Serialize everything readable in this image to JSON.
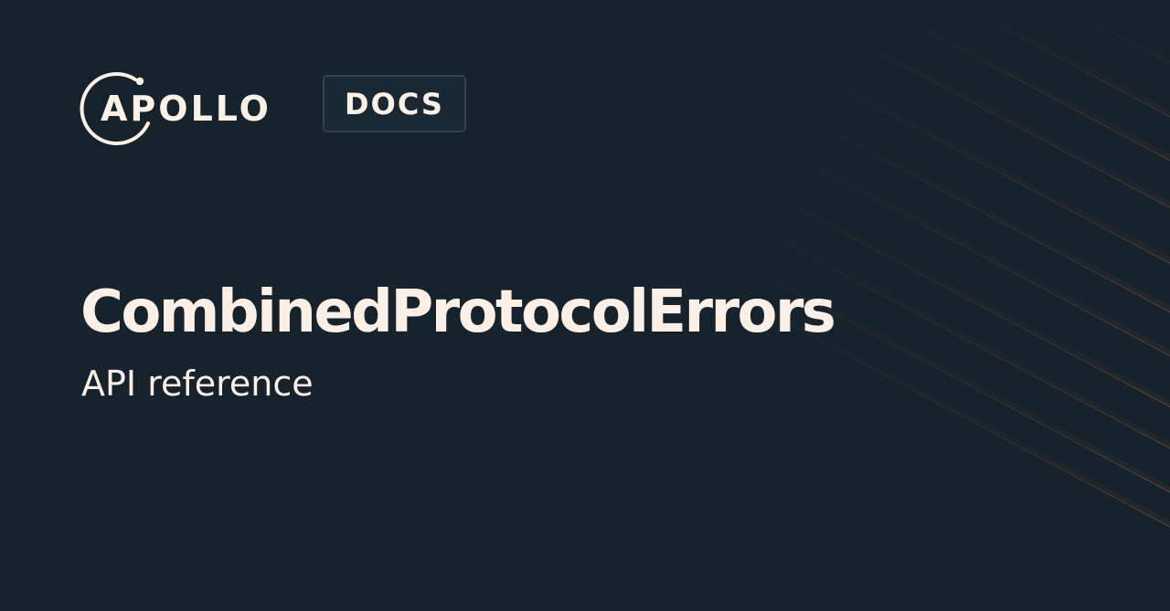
{
  "brand": {
    "wordmark": "APOLLO",
    "badge": "DOCS"
  },
  "heading": {
    "title": "CombinedProtocolErrors",
    "subtitle": "API reference"
  },
  "colors": {
    "background": "#16232c",
    "text": "#fbefe6",
    "accent": "#e07a45",
    "badge_border": "#2f4250"
  },
  "decoration": {
    "icon": "diagonal-lines-pattern"
  }
}
